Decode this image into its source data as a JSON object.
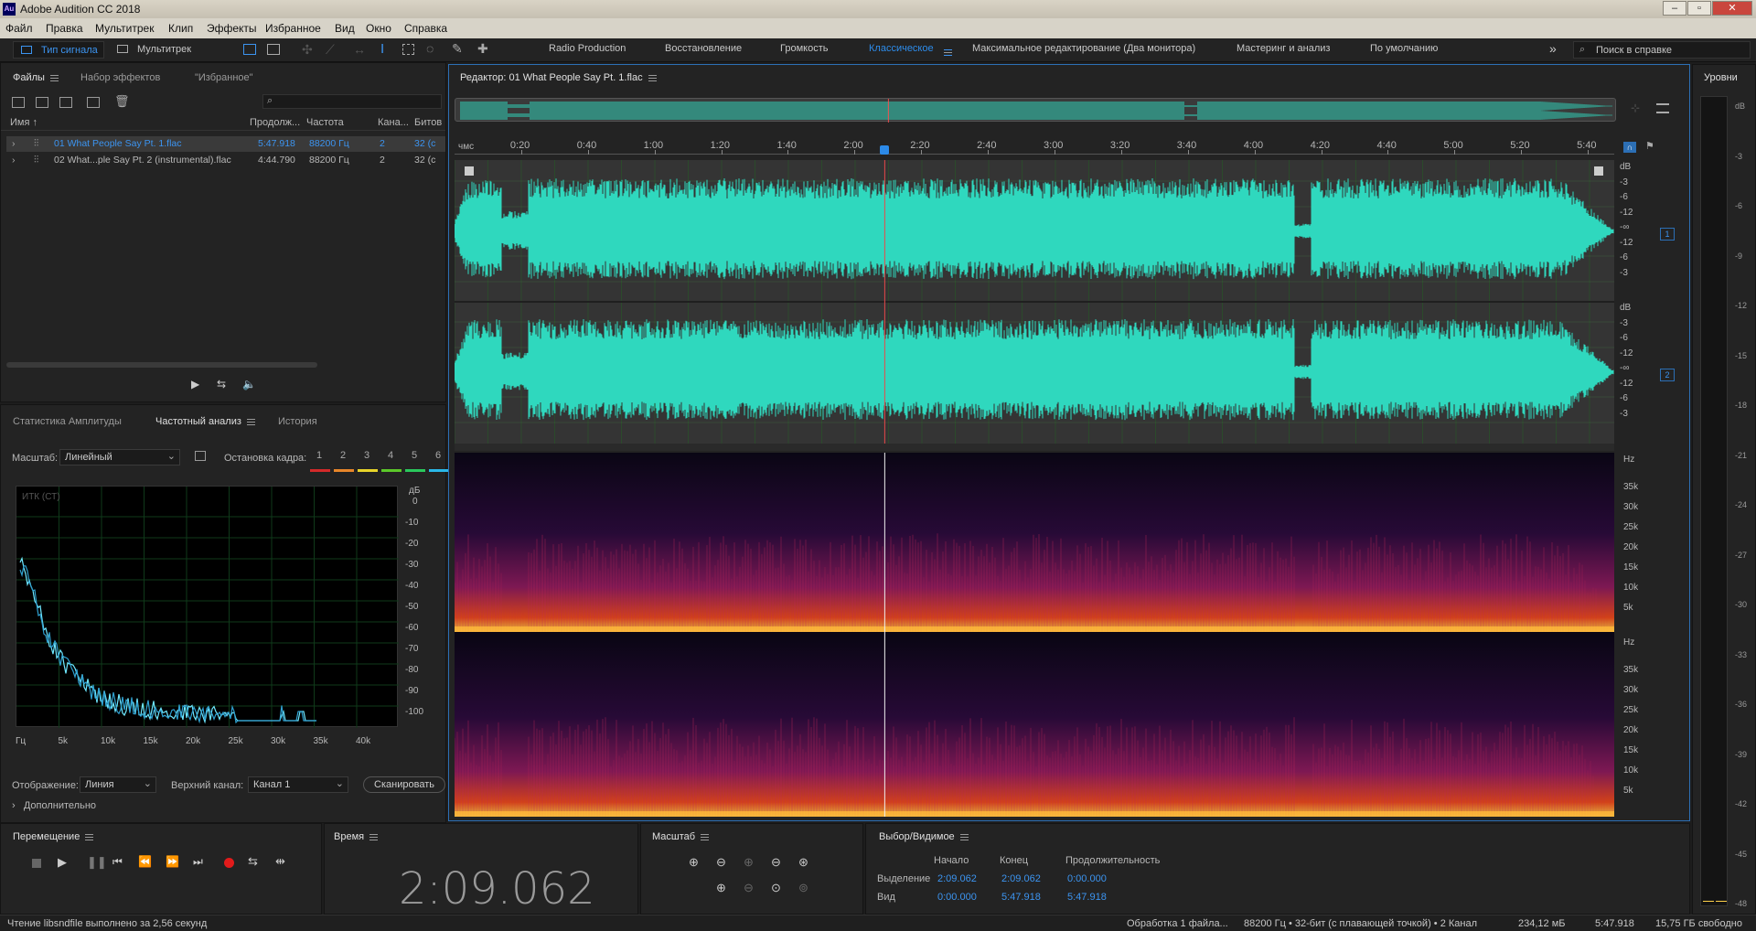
{
  "app": {
    "title": "Adobe Audition CC 2018",
    "logo": "Au"
  },
  "menu": [
    "Файл",
    "Правка",
    "Мультитрек",
    "Клип",
    "Эффекты",
    "Избранное",
    "Вид",
    "Окно",
    "Справка"
  ],
  "toolbar": {
    "waveform": "Тип сигнала",
    "multitrack": "Мультитрек",
    "workspaces": [
      "Radio Production",
      "Восстановление",
      "Громкость",
      "Классическое",
      "Максимальное редактирование (Два монитора)",
      "Мастеринг и анализ",
      "По умолчанию"
    ],
    "active_workspace": "Классическое",
    "help_placeholder": "Поиск в справке"
  },
  "files_panel": {
    "tabs": [
      "Файлы",
      "Набор эффектов",
      "\"Избранное\""
    ],
    "headers": [
      "Имя",
      "Продолж...",
      "Частота",
      "Кана...",
      "Битов"
    ],
    "files": [
      {
        "name": "01 What People Say Pt. 1.flac",
        "duration": "5:47.918",
        "rate": "88200 Гц",
        "channels": "2",
        "bits": "32 (с"
      },
      {
        "name": "02 What...ple Say Pt. 2 (instrumental).flac",
        "duration": "4:44.790",
        "rate": "88200 Гц",
        "channels": "2",
        "bits": "32 (с"
      }
    ]
  },
  "analysis_panel": {
    "tabs": [
      "Статистика Амплитуды",
      "Частотный анализ",
      "История"
    ],
    "scale_label": "Масштаб:",
    "scale_value": "Линейный",
    "freeze_label": "Остановка кадра:",
    "freeze_slots": [
      "1",
      "2",
      "3",
      "4",
      "5",
      "6"
    ],
    "slot_colors": [
      "#d42a2a",
      "#e8862a",
      "#e8d42a",
      "#5cc82a",
      "#2ac85c",
      "#2ab8e8"
    ],
    "graph_label": "ИТК (СТ)",
    "db_unit": "дБ",
    "db_ticks": [
      "0",
      "-10",
      "-20",
      "-30",
      "-40",
      "-50",
      "-60",
      "-70",
      "-80",
      "-90",
      "-100"
    ],
    "freq_ticks": [
      "Гц",
      "5k",
      "10k",
      "15k",
      "20k",
      "25k",
      "30k",
      "35k",
      "40k"
    ],
    "display_label": "Отображение:",
    "display_value": "Линия",
    "channel_label": "Верхний канал:",
    "channel_value": "Канал 1",
    "scan_label": "Сканировать",
    "more_label": "Дополнительно"
  },
  "editor": {
    "title": "Редактор: 01 What People Say Pt. 1.flac",
    "ruler_unit": "чмс",
    "ruler": [
      "0:20",
      "0:40",
      "1:00",
      "1:20",
      "1:40",
      "2:00",
      "2:20",
      "2:40",
      "3:00",
      "3:20",
      "3:40",
      "4:00",
      "4:20",
      "4:40",
      "5:00",
      "5:20",
      "5:40"
    ],
    "db_ticks": [
      "dB",
      "-3",
      "-6",
      "-12",
      "-∞",
      "-12",
      "-6",
      "-3"
    ],
    "channels": [
      "1",
      "2"
    ],
    "hz_ticks": [
      "Hz",
      "35k",
      "30k",
      "25k",
      "20k",
      "15k",
      "10k",
      "5k"
    ],
    "waveform_color": "#2fd8be",
    "playhead_seconds": 129.062,
    "duration_seconds": 347.918
  },
  "levels": {
    "title": "Уровни",
    "ticks": [
      "dB",
      "-3",
      "-6",
      "-9",
      "-12",
      "-15",
      "-18",
      "-21",
      "-24",
      "-27",
      "-30",
      "-33",
      "-36",
      "-39",
      "-42",
      "-45",
      "-48"
    ]
  },
  "transport": {
    "title": "Перемещение"
  },
  "time": {
    "title": "Время",
    "value": "2:09.062"
  },
  "zoom": {
    "title": "Масштаб"
  },
  "selection": {
    "title": "Выбор/Видимое",
    "headers": [
      "Начало",
      "Конец",
      "Продолжительность"
    ],
    "rows": [
      {
        "label": "Выделение",
        "start": "2:09.062",
        "end": "2:09.062",
        "dur": "0:00.000"
      },
      {
        "label": "Вид",
        "start": "0:00.000",
        "end": "5:47.918",
        "dur": "5:47.918"
      }
    ]
  },
  "status": {
    "left": "Чтение libsndfile выполнено за 2,56 секунд",
    "processing": "Обработка 1 файла...",
    "format": "88200 Гц • 32-бит (с плавающей точкой) • 2 Канал",
    "size": "234,12 мБ",
    "duration": "5:47.918",
    "free": "15,75 ГБ свободно"
  }
}
